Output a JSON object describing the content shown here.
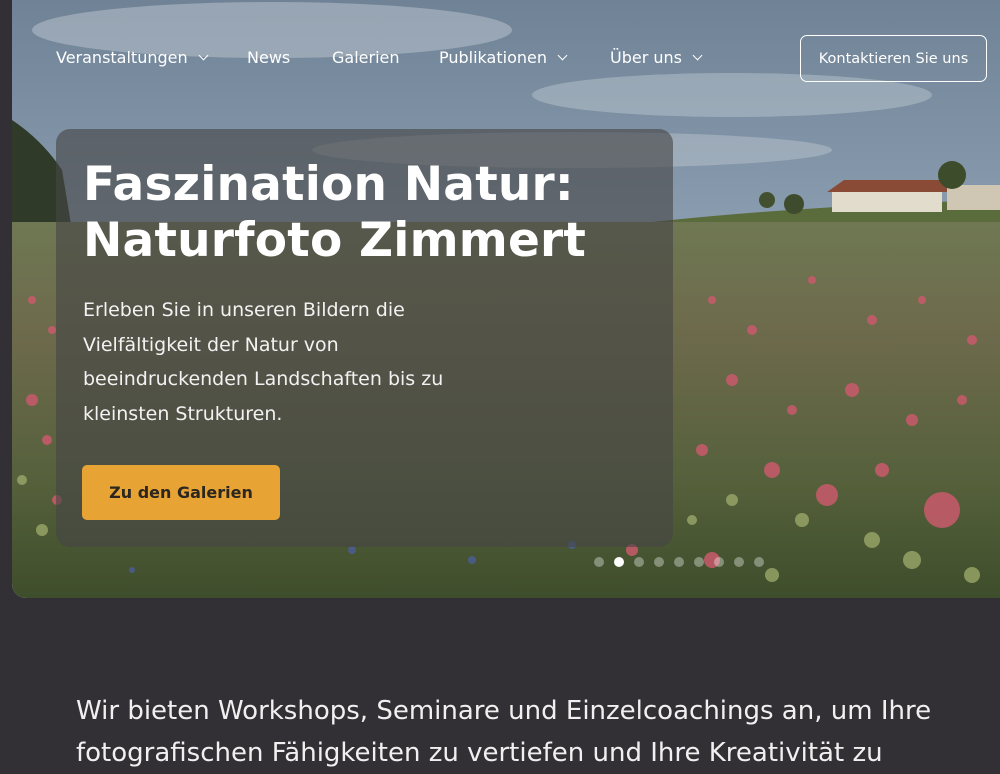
{
  "nav": {
    "items": [
      {
        "label": "Veranstaltungen",
        "has_dropdown": true
      },
      {
        "label": "News",
        "has_dropdown": false
      },
      {
        "label": "Galerien",
        "has_dropdown": false
      },
      {
        "label": "Publikationen",
        "has_dropdown": true
      },
      {
        "label": "Über uns",
        "has_dropdown": true
      }
    ],
    "contact_label": "Kontaktieren Sie uns"
  },
  "hero": {
    "title": "Faszination Natur: Naturfoto Zimmert",
    "text": "Erleben Sie in unseren Bildern die Vielfältigkeit der Natur von beeindruckenden Landschaften bis zu kleinsten Strukturen.",
    "cta_label": "Zu den Galerien",
    "slider": {
      "count": 9,
      "active_index": 1
    }
  },
  "intro": {
    "text": "Wir bieten Workshops, Seminare und Einzelcoachings an, um Ihre fotografischen Fähigkeiten zu vertiefen und Ihre Kreativität zu"
  },
  "colors": {
    "accent": "#e7a333",
    "background": "#323035"
  }
}
